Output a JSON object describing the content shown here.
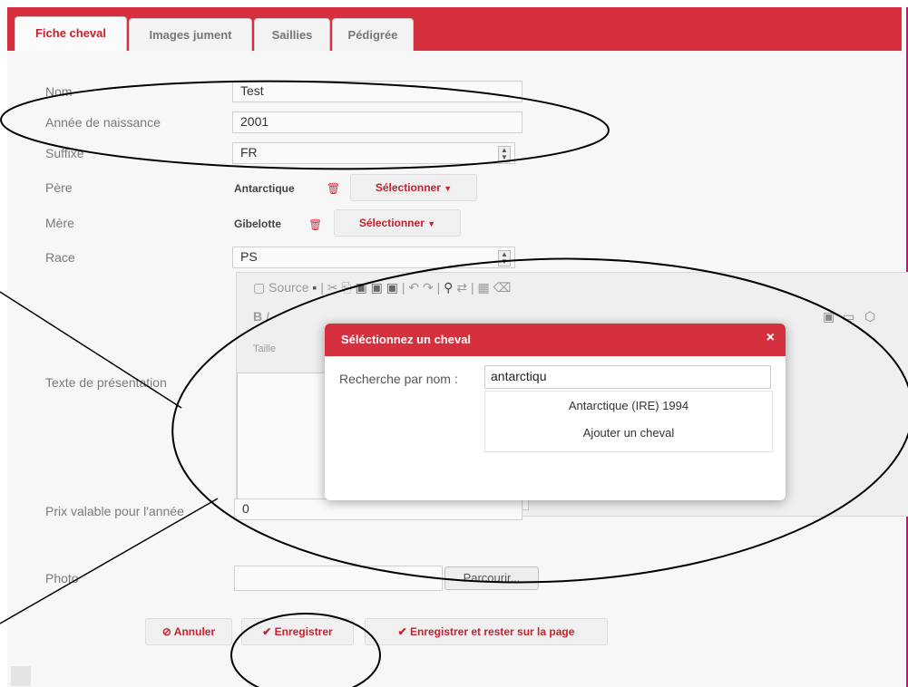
{
  "tabs": [
    {
      "label": "Fiche cheval"
    },
    {
      "label": "Images jument"
    },
    {
      "label": "Saillies"
    },
    {
      "label": "Pédigrée"
    }
  ],
  "form": {
    "nom": {
      "label": "Nom",
      "value": "Test"
    },
    "annee": {
      "label": "Année de naissance",
      "value": "2001"
    },
    "suffixe": {
      "label": "Suffixe",
      "value": "FR"
    },
    "pere": {
      "label": "Père",
      "value": "Antarctique",
      "select_label": "Sélectionner"
    },
    "mere": {
      "label": "Mère",
      "value": "Gibelotte",
      "select_label": "Sélectionner"
    },
    "race": {
      "label": "Race",
      "value": "PS"
    },
    "texte": {
      "label": "Texte de présentation"
    },
    "prix": {
      "label": "Prix valable pour l'année",
      "value": "0"
    },
    "photo": {
      "label": "Photo",
      "browse_label": "Parcourir..."
    }
  },
  "editor": {
    "source_label": "Source",
    "size_label": "Taille"
  },
  "modal": {
    "title": "Séléctionnez un cheval",
    "close": "×",
    "search_label": "Recherche par nom :",
    "search_value": "antarctiqu",
    "results": [
      {
        "label": "Antarctique (IRE) 1994"
      },
      {
        "label": "Ajouter un cheval"
      }
    ]
  },
  "actions": {
    "cancel": "Annuler",
    "save": "Enregistrer",
    "save_stay": "Enregistrer et rester sur la page"
  },
  "colors": {
    "accent": "#d6303f",
    "annotation": "#000000"
  }
}
